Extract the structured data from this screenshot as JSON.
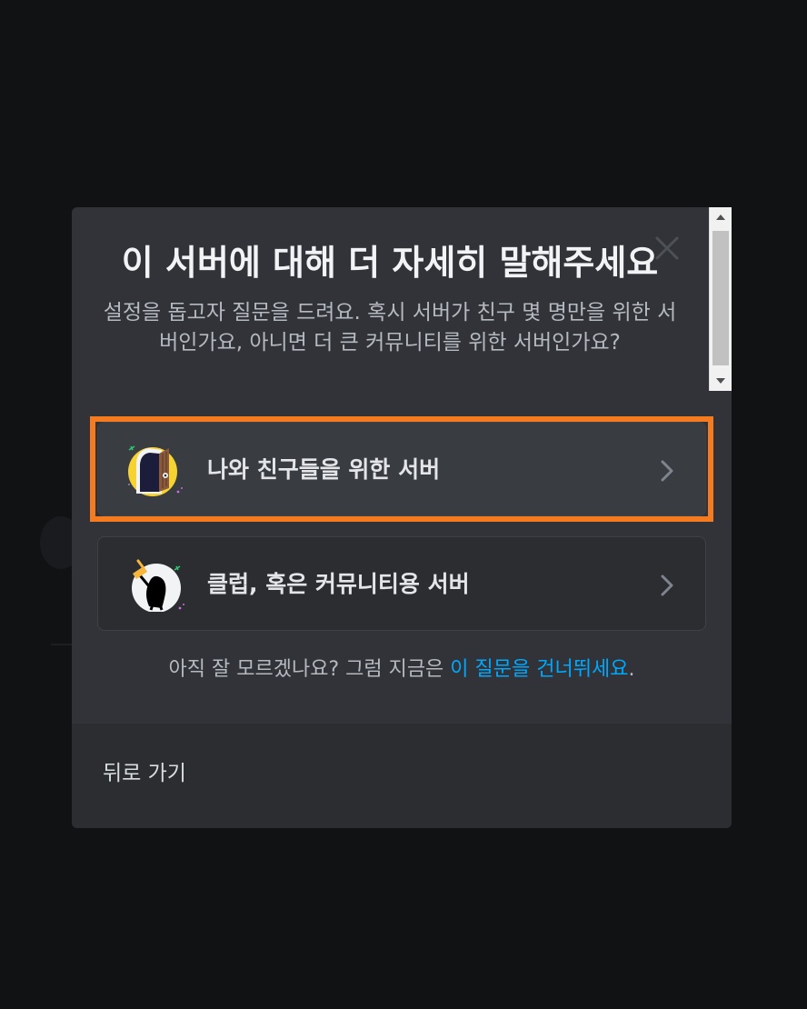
{
  "modal": {
    "title": "이 서버에 대해 더 자세히 말해주세요",
    "subtitle": "설정을 돕고자 질문을 드려요. 혹시 서버가 친구 몇 명만을 위한 서버인가요, 아니면 더 큰 커뮤니티를 위한 서버인가요?",
    "options": [
      {
        "label": "나와 친구들을 위한 서버",
        "icon": "door-icon"
      },
      {
        "label": "클럽, 혹은 커뮤니티용 서버",
        "icon": "club-icon"
      }
    ],
    "skip_prefix": "아직 잘 모르겠나요? 그럼 지금은 ",
    "skip_link": "이 질문을 건너뛰세요",
    "skip_suffix": ".",
    "back_label": "뒤로 가기"
  },
  "colors": {
    "highlight": "#f47b20",
    "link": "#00a8fc",
    "modal_bg": "#313338"
  }
}
